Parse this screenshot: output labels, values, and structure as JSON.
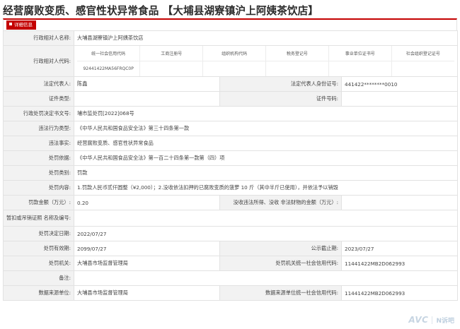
{
  "page": {
    "title": "经营腐败变质、感官性状异常食品 【大埔县湖寮镇沪上阿姨茶饮店】"
  },
  "panel": {
    "tab_label": "详细信息"
  },
  "rows": [
    {
      "l1": "行政相对人名称:",
      "v1": "大埔县湖寮镇沪上阿姨茶饮店"
    },
    {
      "l1": "行政相对人代码:"
    },
    {
      "l1": "法定代表人:",
      "v1": "陈鑫",
      "l2": "法定代表人身份证号:",
      "v2": "441422********0010"
    },
    {
      "l1": "证件类型:",
      "v1": "",
      "l2": "证件号码:",
      "v2": ""
    },
    {
      "l1": "行政处罚决定书文号:",
      "v1": "埔市监处罚[2022]068号"
    },
    {
      "l1": "违法行为类型:",
      "v1": "《中华人民共和国食品安全法》第三十四条第一款"
    },
    {
      "l1": "违法事实:",
      "v1": "经营腐败变质、感官性状异常食品"
    },
    {
      "l1": "处罚依据:",
      "v1": "《中华人民共和国食品安全法》第一百二十四条第一款第（四）项"
    },
    {
      "l1": "处罚类别:",
      "v1": "罚款"
    },
    {
      "l1": "处罚内容:",
      "v1": "1.罚款人民币贰仟圆整（¥2,000）；2.没收依法扣押的已腐败变质的菠萝 10 斤（其中半斤已使用），并依法予以销毁"
    },
    {
      "l1": "罚款金额（万元）:",
      "v1": "0.20",
      "l2": "没收违法所得、没收 非法财物的金额（万元）:",
      "v2": ""
    },
    {
      "l1": "暂扣或吊销证照 名称及编号:",
      "v1": ""
    },
    {
      "l1": "处罚决定日期:",
      "v1": "2022/07/27"
    },
    {
      "l1": "处罚有效期:",
      "v1": "2099/07/27",
      "l2": "公示截止期:",
      "v2": "2023/07/27"
    },
    {
      "l1": "处罚机关:",
      "v1": "大埔县市场监督管理局",
      "l2": "处罚机关统一社会信用代码:",
      "v2": "11441422MB2D062993"
    },
    {
      "l1": "备注:",
      "v1": ""
    },
    {
      "l1": "数据来源单位:",
      "v1": "大埔县市场监督管理局",
      "l2": "数据来源单位统一社会信用代码:",
      "v2": "11441422MB2D062993"
    }
  ],
  "codes": {
    "headers": [
      "统一社会信用代码",
      "工商注册号",
      "组织机构代码",
      "税务登记号",
      "事业单位证书号",
      "社会组织登记证号"
    ],
    "values": [
      "92441422MA56FRQC0P",
      "",
      "",
      "",
      "",
      ""
    ]
  },
  "watermark": {
    "brand": "AVC",
    "sub": "N诉吧"
  }
}
